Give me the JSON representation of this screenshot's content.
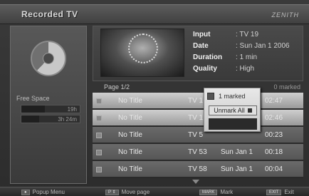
{
  "window": {
    "title": "Recorded TV",
    "brand": "ZENITH"
  },
  "storage": {
    "label": "Free Space",
    "rows": [
      {
        "value": "19h",
        "fill": 0.4
      },
      {
        "value": "3h 24m",
        "fill": 0.3
      }
    ]
  },
  "details": {
    "labels": {
      "input": "Input",
      "date": "Date",
      "duration": "Duration",
      "quality": "Quality"
    },
    "values": {
      "input": ": TV 19",
      "date": ": Sun Jan 1 2006",
      "duration": ": 1 min",
      "quality": ": High"
    }
  },
  "list": {
    "page": "Page  1/2",
    "marked_hint": "0 marked",
    "items": [
      {
        "title": "No Title",
        "channel": "TV 1",
        "date": "",
        "time": "02:47",
        "selected": true
      },
      {
        "title": "No Title",
        "channel": "TV 1",
        "date": "",
        "time": "02:46",
        "selected": false
      },
      {
        "title": "No Title",
        "channel": "TV 5",
        "date": "",
        "time": "00:23",
        "selected": false
      },
      {
        "title": "No Title",
        "channel": "TV 53",
        "date": "Sun Jan 1",
        "time": "00:18",
        "selected": false
      },
      {
        "title": "No Title",
        "channel": "TV 58",
        "date": "Sun Jan 1",
        "time": "00:04",
        "selected": false
      }
    ]
  },
  "popup": {
    "marked": "1  marked",
    "unmark_all": "Unmark All"
  },
  "footer": {
    "popup_menu": "Popup Menu",
    "move_page": "Move page",
    "mark_key": "MARK",
    "mark": "Mark",
    "exit_key": "EXIT",
    "exit": "Exit"
  },
  "colors": {
    "selected_row": "#bdbdbd",
    "row": "#5f5f5f",
    "popup": "#dcdcdc"
  }
}
